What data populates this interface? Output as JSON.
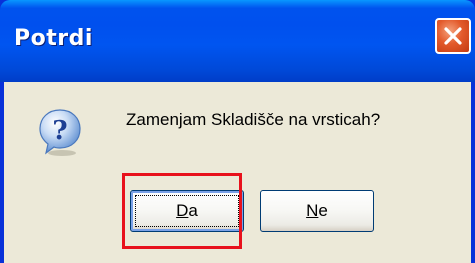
{
  "dialog": {
    "title": "Potrdi",
    "message": "Zamenjam Skladišče na vrsticah?",
    "icon": "question-icon"
  },
  "buttons": {
    "yes": {
      "accel": "D",
      "rest": "a"
    },
    "no": {
      "accel": "N",
      "rest": "e"
    }
  },
  "colors": {
    "titlebar": "#0054e3",
    "close": "#e35a2b",
    "client": "#ece9d8",
    "highlight": "#e8111c"
  }
}
